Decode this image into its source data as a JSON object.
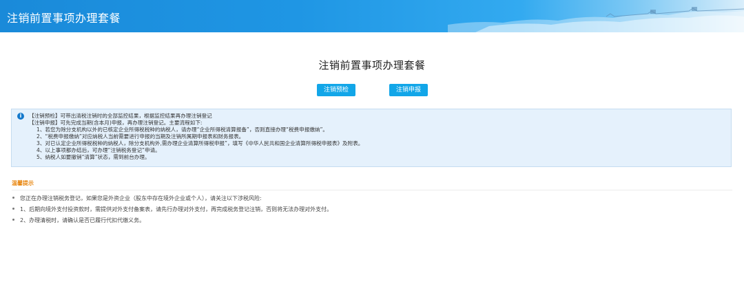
{
  "header": {
    "title": "注销前置事项办理套餐"
  },
  "main": {
    "title": "注销前置事项办理套餐",
    "buttons": {
      "precheck": "注销预检",
      "declare": "注销申报"
    }
  },
  "info": {
    "line1": "【注销预检】可带出清税注销时的全部监控结果，根据监控结果再办理注销登记",
    "line2": "【注销申报】可先完成当期(含本月)申报，再办理注销登记。主要流程如下:",
    "steps": [
      "1、若您为除分支机构以外的已核定企业所得税税种的纳税人，请办理“企业所得税清算报备”，否则直接办理“税费申报缴纳”。",
      "2、“税费申报缴纳”对应纳税人当前需要进行申报的当期及注销所属期申报表和财务报表。",
      "3、对已认定企业所得税税种的纳税人，除分支机构外,需办理企业清算所得税申报”，填写《中华人民共和国企业清算所得税申报表》及附表。",
      "4、以上事项都办结后，可办理“注销税务登记”申请。",
      "5、纳税人如要撤销“清算”状态，需到前台办理。"
    ]
  },
  "tips": {
    "title": "温馨提示",
    "items": [
      "您正在办理注销税务登记，如果您是外资企业（股东中存在境外企业或个人），请关注以下涉税风险:",
      "1、后期向境外支付投资款时，需提供对外支付备案表，请先行办理对外支付，再完成税务登记注销，否则将无法办理对外支付。",
      "2、办理清税时，请确认是否已履行代扣代缴义务。"
    ]
  }
}
